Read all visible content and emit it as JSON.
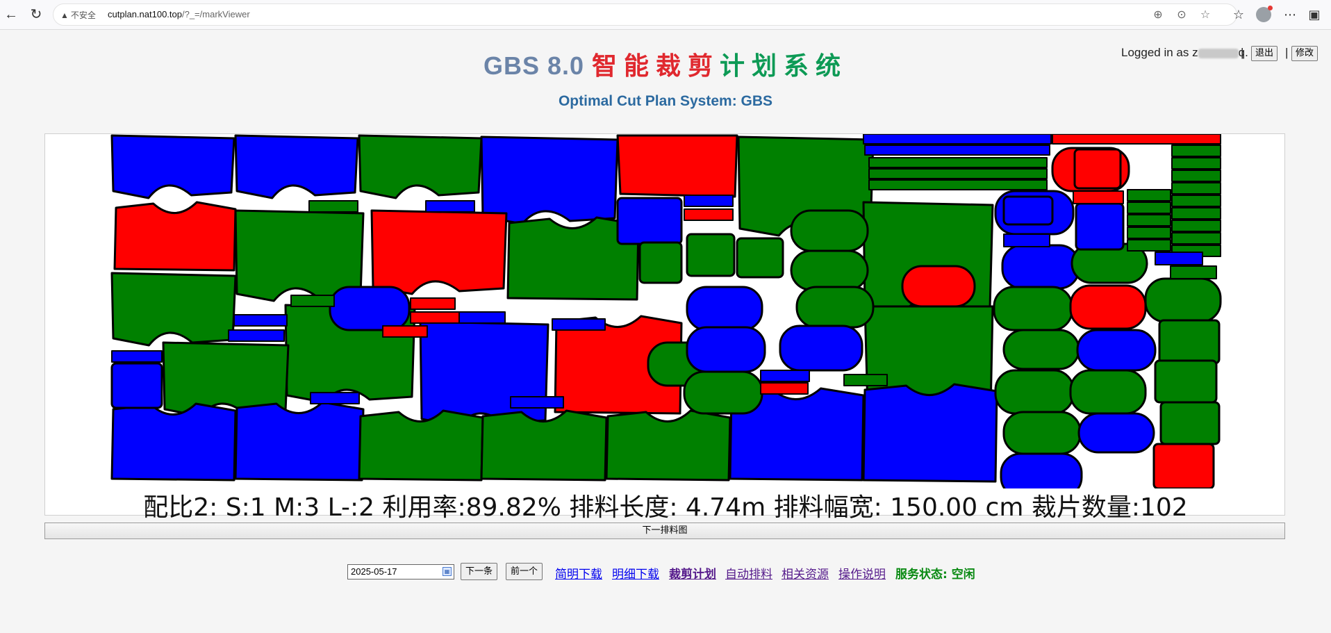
{
  "browser": {
    "security_label": "不安全",
    "url_host": "cutplan.nat100.top",
    "url_path": "/?_=/markViewer"
  },
  "header": {
    "title_gbs": "GBS 8.0",
    "title_cn_red": "智能裁剪",
    "title_cn_green": "计划系统",
    "subtitle": "Optimal Cut Plan System: GBS",
    "login_prefix": "Logged in as",
    "login_user_visible": "z",
    "login_user_tail": "q.",
    "pipe": "|",
    "logout_label": "退出",
    "modify_label": "修改"
  },
  "marker": {
    "caption": "配比2: S:1 M:3 L-:2 利用率:89.82% 排料长度: 4.74m 排料幅宽: 150.00 cm 裁片数量:102",
    "ratio": {
      "S": 1,
      "M": 3,
      "L-": 2
    },
    "utilization_percent": 89.82,
    "length_m": 4.74,
    "width_cm": 150.0,
    "piece_count": 102,
    "colors": {
      "blue": "#0000ff",
      "red": "#ff0000",
      "green": "#008000",
      "outline": "#000000"
    }
  },
  "next_marker_label": "下一排料图",
  "toolbar": {
    "date_value": "2025-05-17",
    "next_label": "下一条",
    "prev_label": "前一个",
    "links": [
      {
        "label": "简明下载",
        "color": "#0000ee",
        "bold": false
      },
      {
        "label": "明细下载",
        "color": "#0000ee",
        "bold": false
      },
      {
        "label": "裁剪计划",
        "color": "#551a8b",
        "bold": true
      },
      {
        "label": "自动排料",
        "color": "#551a8b",
        "bold": false
      },
      {
        "label": "相关资源",
        "color": "#551a8b",
        "bold": false
      },
      {
        "label": "操作说明",
        "color": "#551a8b",
        "bold": false
      }
    ],
    "status_label": "服务状态:",
    "status_value": "空闲"
  }
}
